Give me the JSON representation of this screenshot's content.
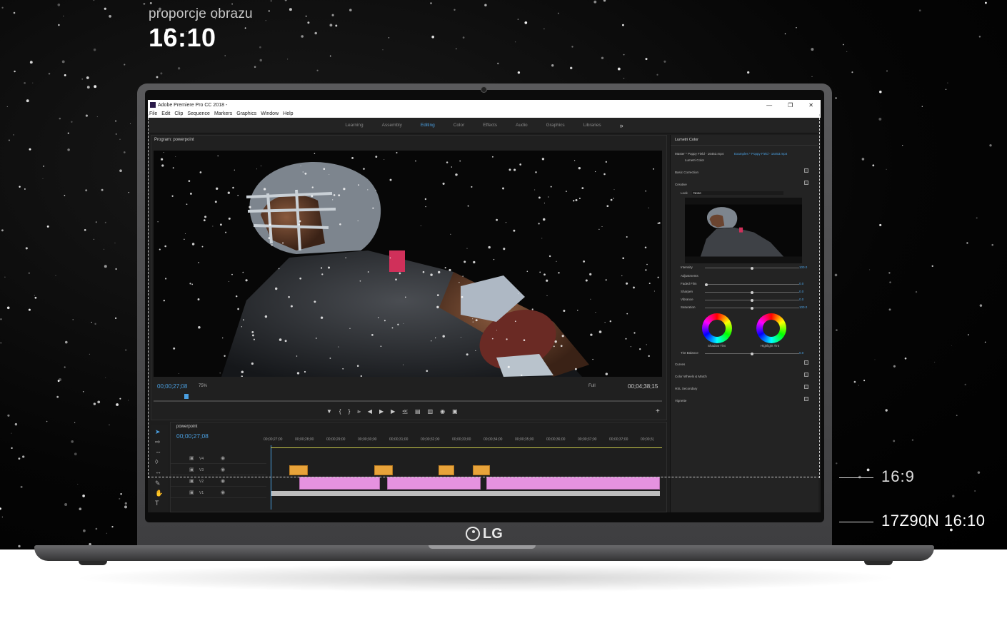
{
  "header": {
    "subtitle": "proporcje obrazu",
    "title": "16:10"
  },
  "app": {
    "window_title": "Adobe Premiere Pro CC 2018 -",
    "menu": [
      "File",
      "Edit",
      "Clip",
      "Sequence",
      "Markers",
      "Graphics",
      "Window",
      "Help"
    ],
    "workspaces": [
      "Learning",
      "Assembly",
      "Editing",
      "Color",
      "Effects",
      "Audio",
      "Graphics",
      "Libraries"
    ],
    "active_workspace": "Editing",
    "more_label": "»"
  },
  "program_monitor": {
    "title": "Program: powerpoint",
    "timecode_current": "00;00;27;08",
    "zoom": "75%",
    "resolution": "Full",
    "timecode_duration": "00;04;38;15"
  },
  "lumetri": {
    "title": "Lumetri Color",
    "master": "Master * Poppy Field - 16453.mp4",
    "clip": "Examples * Poppy Field - 16453.mp4",
    "effect": "Lumetri Color",
    "sections": {
      "basic": "Basic Correction",
      "creative": "Creative",
      "curves": "Curves",
      "wheels": "Color Wheels & Match",
      "hsl": "HSL Secondary",
      "vignette": "Vignette"
    },
    "look_label": "Look",
    "look_value": "None",
    "intensity_label": "Intensity",
    "intensity_value": "100.0",
    "adjustments_label": "Adjustments",
    "sliders": [
      {
        "label": "Faded Film",
        "value": "0.0",
        "level": 0.0
      },
      {
        "label": "Sharpen",
        "value": "0.0",
        "level": 0.5
      },
      {
        "label": "Vibrance",
        "value": "0.0",
        "level": 0.5
      },
      {
        "label": "Saturation",
        "value": "100.0",
        "level": 0.5
      }
    ],
    "shadow_tint": "Shadow Tint",
    "highlight_tint": "Highlight Tint",
    "tint_balance_label": "Tint Balance",
    "tint_balance_value": "0.0"
  },
  "timeline": {
    "sequence": "powerpoint",
    "timecode": "00;00;27;08",
    "ruler": [
      "00;00;27;00",
      "00;00;28;00",
      "00;00;29;00",
      "00;00;30;00",
      "00;00;31;00",
      "00;00;32;00",
      "00;00;33;00",
      "00;00;34;00",
      "00;00;35;00",
      "00;00;36;00",
      "00;00;37;00",
      "00;00;37;00",
      "00;00;3("
    ],
    "tracks": [
      "V4",
      "V3",
      "V2",
      "V1"
    ]
  },
  "annotations": {
    "ratio_16_9": "16:9",
    "ratio_model": "17Z90N 16:10"
  },
  "brand": {
    "logo": "LG"
  },
  "colors": {
    "accent": "#4a9fe0",
    "clip_orange": "#e8a33a",
    "clip_pink": "#e592e0"
  }
}
